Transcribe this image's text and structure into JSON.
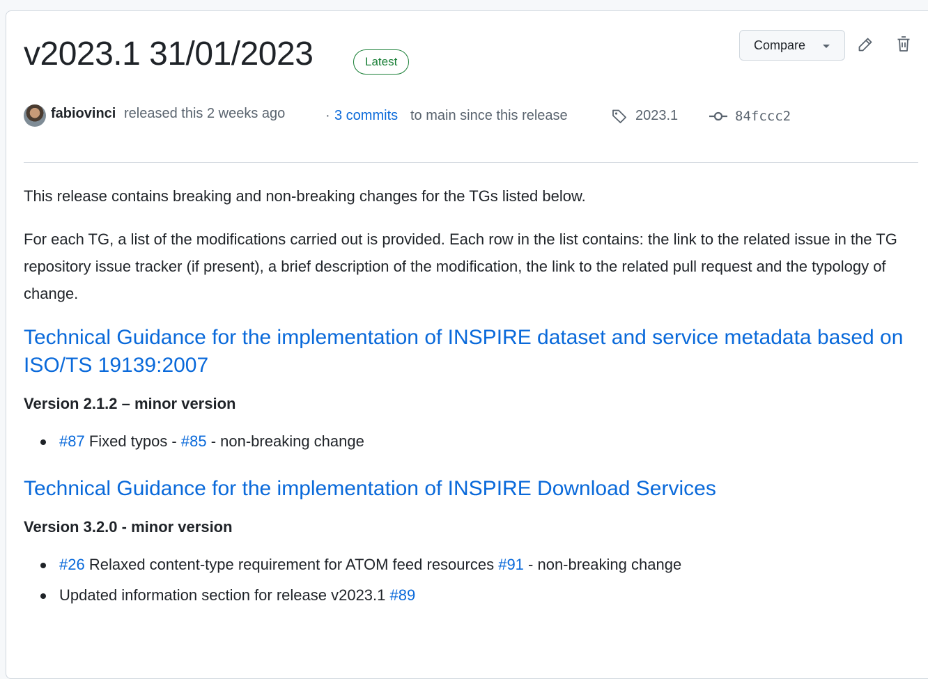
{
  "release": {
    "title": "v2023.1 31/01/2023",
    "badge": "Latest",
    "compare_label": "Compare",
    "author": "fabiovinci",
    "released_text": "released this 2 weeks ago",
    "separator": "·",
    "commits_link": "3 commits",
    "commits_rest": "to main since this release",
    "tag": "2023.1",
    "commit_sha": "84fccc2"
  },
  "body": {
    "p1": "This release contains breaking and non-breaking changes for the TGs listed below.",
    "p2": "For each TG, a list of the modifications carried out is provided. Each row in the list contains: the link to the related issue in the TG repository issue tracker (if present), a brief description of the modification, the link to the related pull request and the typology of change.",
    "sections": [
      {
        "heading": "Technical Guidance for the implementation of INSPIRE dataset and service metadata based on ISO/TS 19139:2007",
        "version": "Version 2.1.2 – minor version",
        "items": [
          {
            "issue": "#87",
            "text": " Fixed typos - ",
            "pr": "#85",
            "tail": " - non-breaking change"
          }
        ]
      },
      {
        "heading": "Technical Guidance for the implementation of INSPIRE Download Services",
        "version": "Version 3.2.0 - minor version",
        "items": [
          {
            "issue": "#26",
            "text": " Relaxed content-type requirement for ATOM feed resources ",
            "pr": "#91",
            "tail": " - non-breaking change"
          },
          {
            "text": "Updated information section for release v2023.1 ",
            "pr": "#89"
          }
        ]
      }
    ]
  },
  "colors": {
    "accent": "#0969da",
    "latest": "#1a7f37",
    "muted": "#59636e",
    "text": "#1f2328"
  },
  "icons": [
    "caret-down-icon",
    "pencil-icon",
    "trash-icon",
    "tag-icon",
    "git-commit-icon"
  ]
}
